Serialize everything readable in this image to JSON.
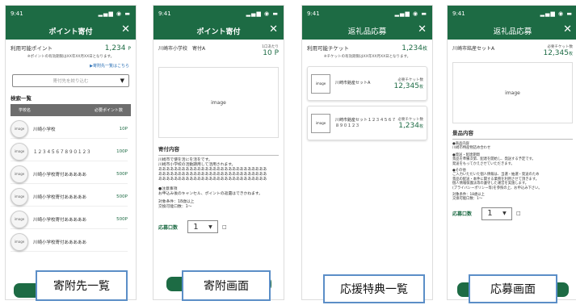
{
  "status_time": "9:41",
  "colors": {
    "primary": "#1d6b44",
    "tag_border": "#5b8ec7"
  },
  "close_icon": "close-icon",
  "screen1": {
    "title": "ポイント寄付",
    "points_label": "利用可能ポイント",
    "points_value": "1,234",
    "points_unit": "P",
    "note": "※ポイントの有効期限はXX年XX月XX日となります。",
    "link": "▶寄附先一覧はこちら",
    "select_placeholder": "寄付先を絞り込む",
    "list_title": "検索一覧",
    "col_name": "学校名",
    "col_points": "必要ポイント数",
    "image_label": "image",
    "items": [
      {
        "name": "川崎小学校",
        "points": "10P"
      },
      {
        "name": "１２３４５６７８９０１２３",
        "points": "100P"
      },
      {
        "name": "川崎小学校寄付あああああ",
        "points": "500P"
      },
      {
        "name": "川崎小学校寄付あああああ",
        "points": "500P"
      },
      {
        "name": "川崎小学校寄付あああああ",
        "points": "500P"
      },
      {
        "name": "川崎小学校寄付あああああ",
        "points": ""
      }
    ],
    "caption": "寄附先一覧"
  },
  "screen2": {
    "title": "ポイント寄付",
    "donee": "川崎市小学校　寄付A",
    "unit_label": "1口あたり",
    "unit_value": "10",
    "unit_suffix": "P",
    "image_label": "image",
    "content_title": "寄付内容",
    "lines": [
      "川崎市で使を活にを活をです。",
      "川崎市小学校の活動期用して活用されます。",
      "ああああああああああああああああああああああああああああ",
      "ああああああああああああああああああああああああああああ",
      "ああああああああああああああああああああああああああああ"
    ],
    "notes": [
      "●注意事項",
      "お申込み後のキャンセル、ポイントの返還はできかねます。",
      "",
      "対象条件：18歳以上",
      "交換可能口数：1～"
    ],
    "apply_label": "応募口数",
    "qty": "1",
    "caret": "▼",
    "info_icon": "□",
    "caption": "寄附画面"
  },
  "screen3": {
    "title": "返礼品応募",
    "tickets_label": "利用可能チケット",
    "tickets_value": "1,234",
    "tickets_unit": "枚",
    "note": "※チケットの有効期限はXX年XX月XX日となります。",
    "items": [
      {
        "thumb": "image",
        "name": "川崎市銘産セットA",
        "req_label": "必要チケット数",
        "req_value": "12,345",
        "req_unit": "枚"
      },
      {
        "thumb": "image",
        "name": "川崎市銘産セット１２３４５６７８９０１２３",
        "req_label": "必要チケット数",
        "req_value": "1,234",
        "req_unit": "枚"
      }
    ],
    "caption": "応援特典一覧"
  },
  "screen4": {
    "title": "返礼品応募",
    "item_name": "川崎市銘産セットA",
    "req_label": "必要チケット数",
    "req_value": "12,345",
    "req_unit": "枚",
    "image_label": "image",
    "content_title": "景品内容",
    "lines": [
      "●商品内容",
      "川崎市特産物詰め合わせ",
      "",
      "●発送・配達期間",
      "景品を準備次第、配達を開始し、発送する予定です。",
      "発送をもってかえさせていただきます。",
      "",
      "●その他",
      "ご入力いただいた個人情報は、当選・抽選・発送のため",
      "景品の配送・本件に関する業務を利用させて頂きます。",
      "個人情報保護法等の遵守した運営を実施します。",
      "(プライバシーポリシー等)を参照の上、お申込み下さい。",
      "",
      "対象条件：18歳以上",
      "交換可能口数：1～"
    ],
    "apply_label": "応募口数",
    "qty": "1",
    "caret": "▼",
    "info_icon": "□",
    "caption": "応募画面"
  }
}
